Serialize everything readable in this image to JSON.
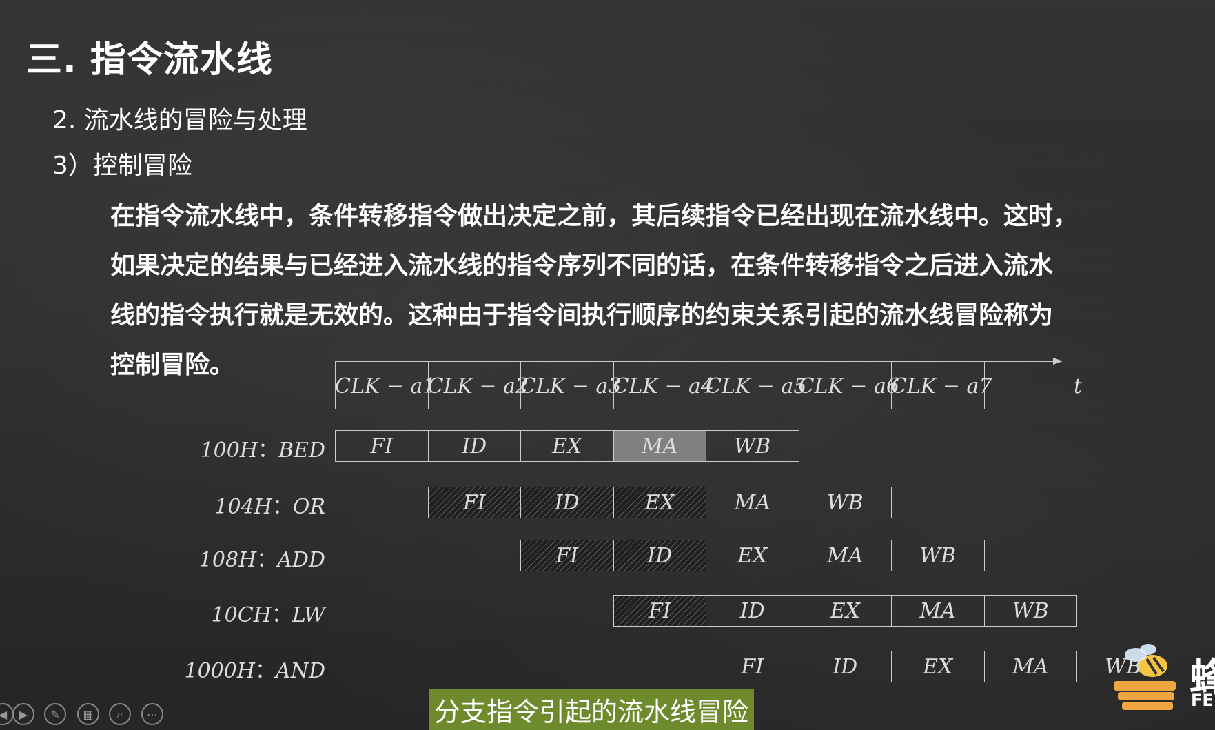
{
  "title": "三. 指令流水线",
  "subtitle1": "2. 流水线的冒险与处理",
  "subtitle2": "3）控制冒险",
  "paragraph": [
    "在指令流水线中，条件转移指令做出决定之前，其后续指令已经出现在流水线中。这时，",
    "如果决定的结果与已经进入流水线的指令序列不同的话，在条件转移指令之后进入流水",
    "线的指令执行就是无效的。这种由于指令间执行顺序的约束关系引起的流水线冒险称为",
    "控制冒险。"
  ],
  "axis": {
    "clocks": [
      "CLK − a1",
      "CLK − a2",
      "CLK − a3",
      "CLK − a4",
      "CLK − a5",
      "CLK − a6",
      "CLK − a7"
    ],
    "end_label": "t"
  },
  "rows": [
    {
      "addr": "100H",
      "sep": "：",
      "op": "BED",
      "start": 0,
      "stages": [
        {
          "name": "FI",
          "style": "plain"
        },
        {
          "name": "ID",
          "style": "plain"
        },
        {
          "name": "EX",
          "style": "plain"
        },
        {
          "name": "MA",
          "style": "gray"
        },
        {
          "name": "WB",
          "style": "plain"
        }
      ]
    },
    {
      "addr": "104H",
      "sep": "：",
      "op": "OR",
      "start": 1,
      "stages": [
        {
          "name": "FI",
          "style": "hatch"
        },
        {
          "name": "ID",
          "style": "hatch"
        },
        {
          "name": "EX",
          "style": "hatch"
        },
        {
          "name": "MA",
          "style": "plain"
        },
        {
          "name": "WB",
          "style": "plain"
        }
      ]
    },
    {
      "addr": "108H",
      "sep": "：",
      "op": "ADD",
      "start": 2,
      "stages": [
        {
          "name": "FI",
          "style": "hatch"
        },
        {
          "name": "ID",
          "style": "hatch"
        },
        {
          "name": "EX",
          "style": "plain"
        },
        {
          "name": "MA",
          "style": "plain"
        },
        {
          "name": "WB",
          "style": "plain"
        }
      ]
    },
    {
      "addr": "10CH",
      "sep": "：",
      "op": "LW",
      "start": 3,
      "stages": [
        {
          "name": "FI",
          "style": "hatch"
        },
        {
          "name": "ID",
          "style": "plain"
        },
        {
          "name": "EX",
          "style": "plain"
        },
        {
          "name": "MA",
          "style": "plain"
        },
        {
          "name": "WB",
          "style": "plain"
        }
      ]
    },
    {
      "addr": "1000H",
      "sep": "：",
      "op": "AND",
      "start": 4,
      "stages": [
        {
          "name": "FI",
          "style": "plain"
        },
        {
          "name": "ID",
          "style": "plain"
        },
        {
          "name": "EX",
          "style": "plain"
        },
        {
          "name": "MA",
          "style": "plain"
        },
        {
          "name": "WB",
          "style": "plain"
        }
      ]
    }
  ],
  "caption": "分支指令引起的流水线冒险",
  "player_controls": [
    "prev-icon",
    "play-icon",
    "pen-icon",
    "slides-icon",
    "zoom-icon",
    "more-icon"
  ],
  "logo": {
    "text": "蜂",
    "sub": "FE"
  },
  "colors": {
    "hatch_dark": "#202020",
    "highlight_gray": "#808080",
    "caption_bg": "#6d8a2d"
  }
}
